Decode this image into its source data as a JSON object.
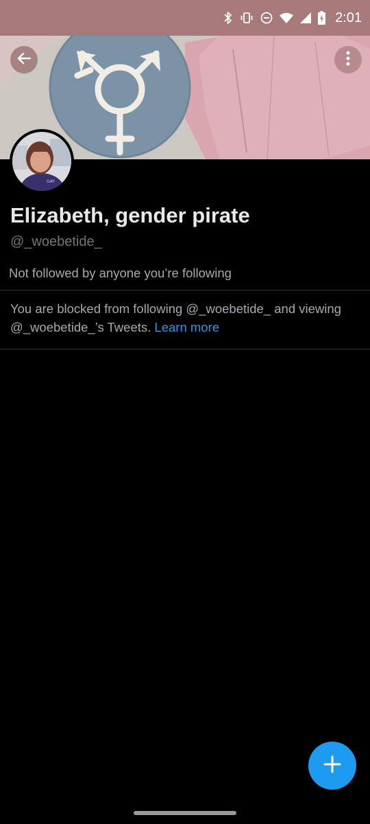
{
  "status_bar": {
    "time": "2:01",
    "icons": [
      "bluetooth-icon",
      "vibrate-icon",
      "do-not-disturb-icon",
      "wifi-icon",
      "cell-signal-icon",
      "battery-charging-icon"
    ],
    "background_color": "#a7797a"
  },
  "header": {
    "back_icon": "arrow-left-icon",
    "more_icon": "more-vertical-icon",
    "banner_image": "transgender-symbol-flag-banner"
  },
  "profile": {
    "avatar": "profile-photo",
    "display_name": "Elizabeth, gender pirate",
    "handle": "@_woebetide_",
    "followers_context": "Not followed by anyone you’re following"
  },
  "blocked_notice": {
    "text": "You are blocked from following @_woebetide_ and viewing @_woebetide_’s Tweets. ",
    "link_label": "Learn more"
  },
  "fab": {
    "icon": "plus-icon"
  },
  "colors": {
    "background": "#000000",
    "accent": "#1d9bf0",
    "primary_text": "#e7e9ea",
    "secondary_text": "#71767b",
    "divider": "#2f3336"
  }
}
